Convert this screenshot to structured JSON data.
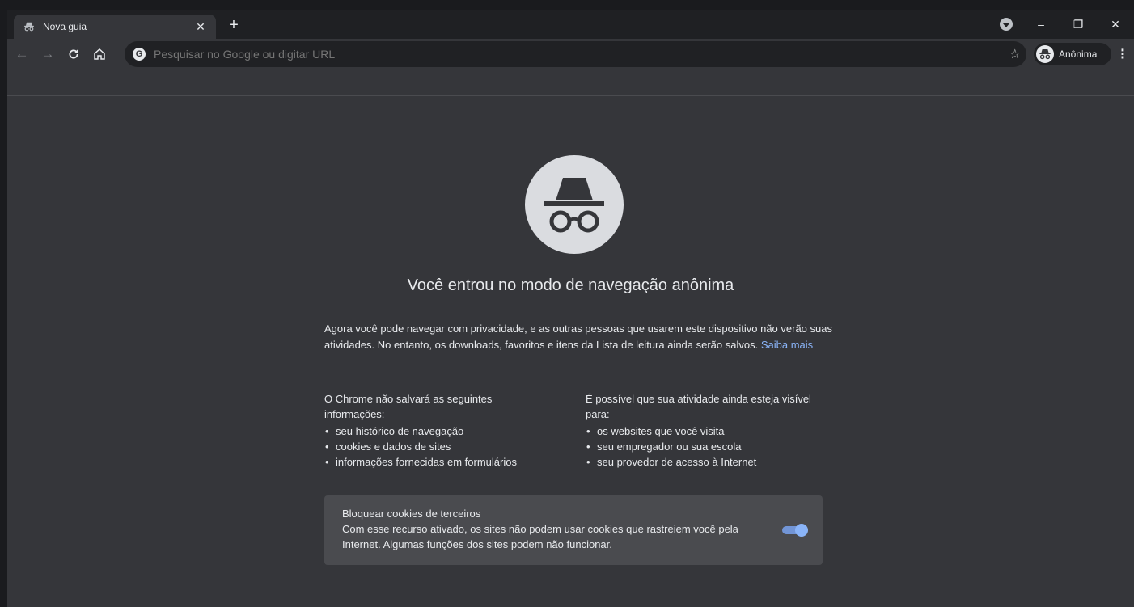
{
  "tab": {
    "title": "Nova guia",
    "close_glyph": "✕",
    "icon": "incognito-icon"
  },
  "new_tab_glyph": "+",
  "window_controls": {
    "minimize": "–",
    "restore": "❐",
    "close": "✕"
  },
  "toolbar": {
    "back_glyph": "←",
    "forward_glyph": "→",
    "reload_glyph": "C",
    "home_glyph": "⌂",
    "omnibox_placeholder": "Pesquisar no Google ou digitar URL",
    "google_glyph": "G",
    "star_glyph": "☆",
    "profile_label": "Anônima",
    "menu_glyph": "⋮"
  },
  "content": {
    "headline": "Você entrou no modo de navegação anônima",
    "intro": "Agora você pode navegar com privacidade, e as outras pessoas que usarem este dispositivo não verão suas atividades. No entanto, os downloads, favoritos e itens da Lista de leitura ainda serão salvos.",
    "learn_more": "Saiba mais",
    "left_column": {
      "heading": "O Chrome não salvará as seguintes informações:",
      "items": [
        "seu histórico de navegação",
        "cookies e dados de sites",
        "informações fornecidas em formulários"
      ]
    },
    "right_column": {
      "heading": "É possível que sua atividade ainda esteja visível para:",
      "items": [
        "os websites que você visita",
        "seu empregador ou sua escola",
        "seu provedor de acesso à Internet"
      ]
    },
    "cookie_card": {
      "title": "Bloquear cookies de terceiros",
      "text": "Com esse recurso ativado, os sites não podem usar cookies que rastreiem você pela Internet. Algumas funções dos sites podem não funcionar.",
      "toggle_on": true
    }
  },
  "colors": {
    "accent": "#8ab4f8",
    "background": "#35363a",
    "card": "#4a4b4f"
  }
}
